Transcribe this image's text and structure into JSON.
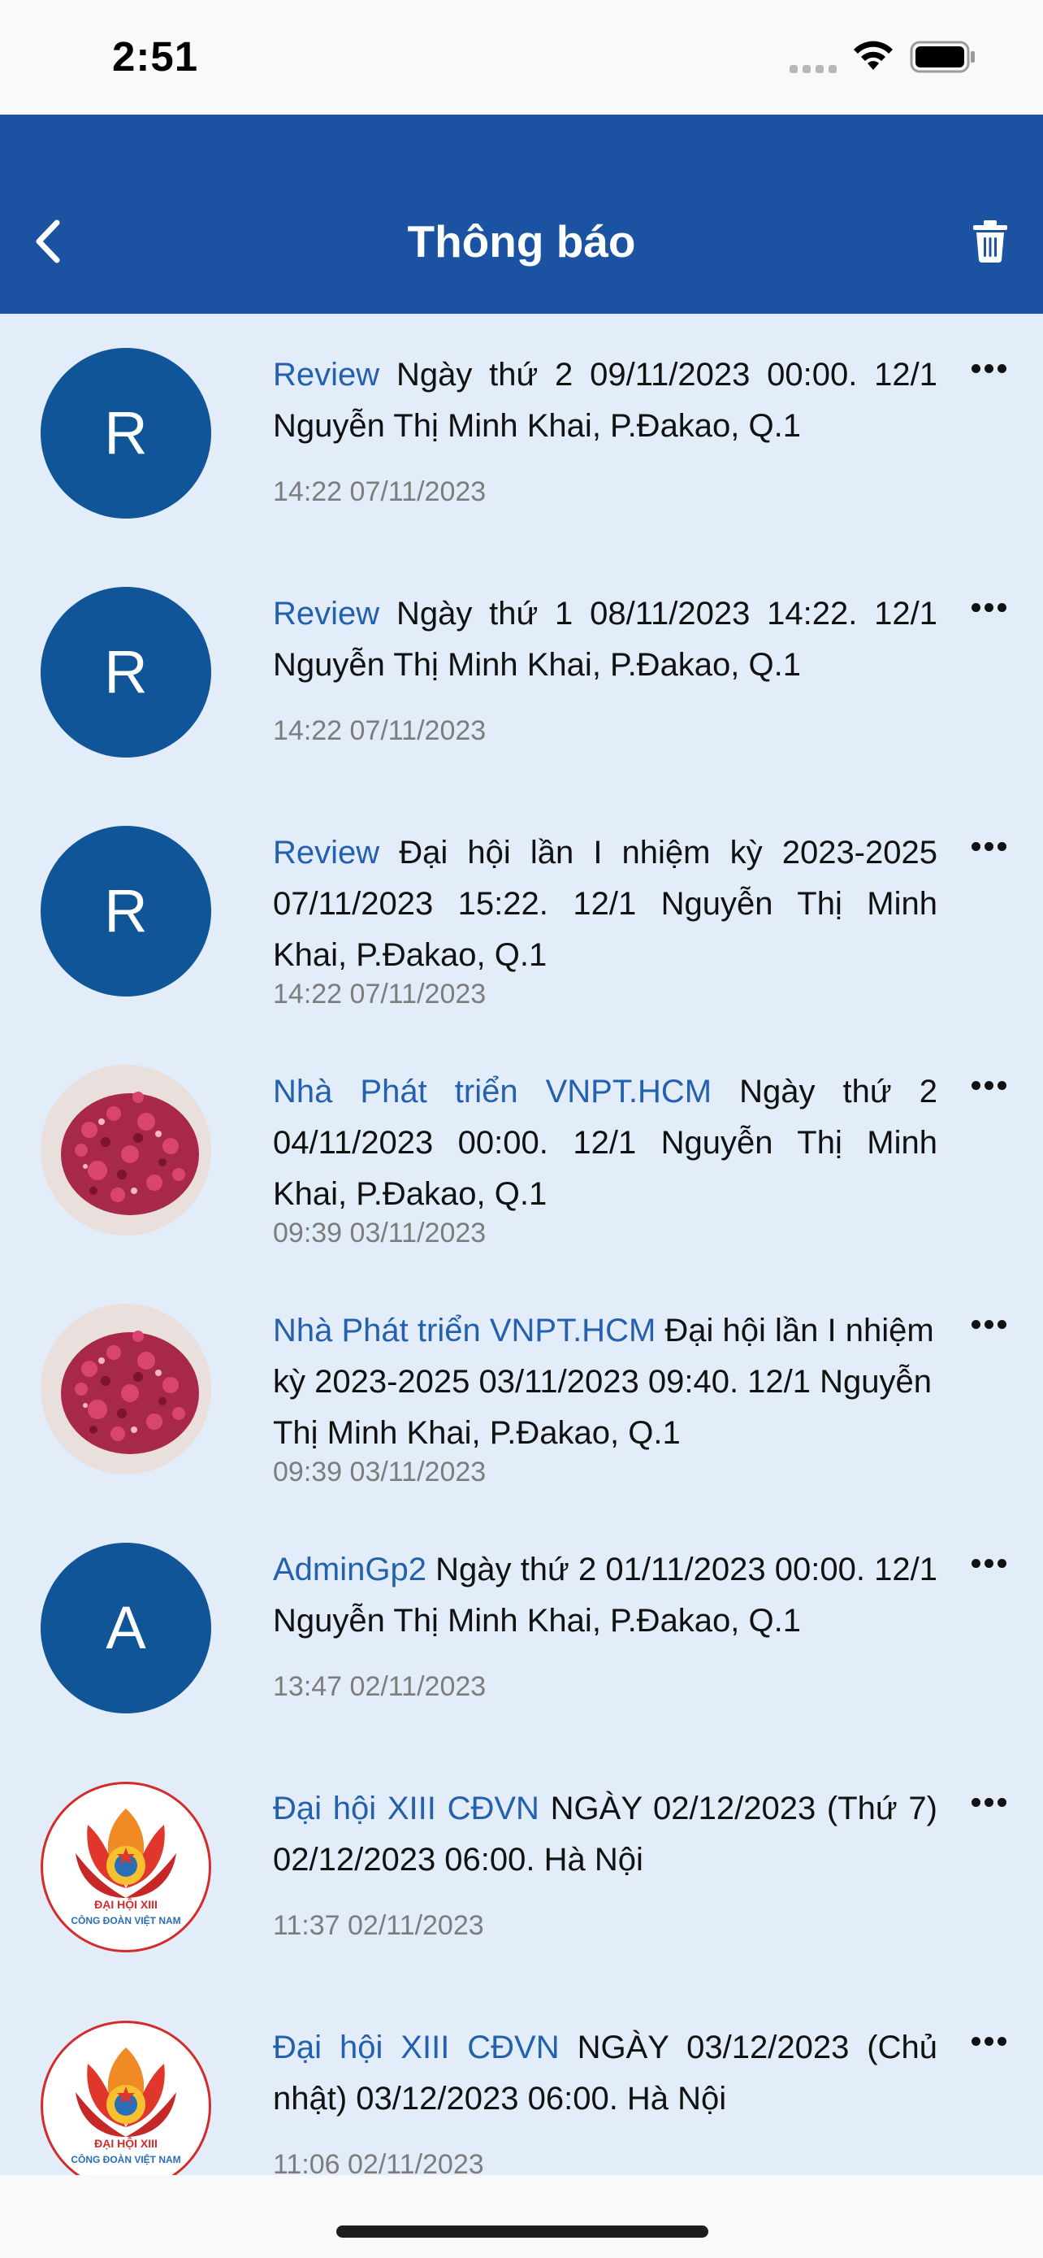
{
  "status_bar": {
    "time": "2:51"
  },
  "header": {
    "title": "Thông báo",
    "back_icon": "chevron-left-icon",
    "delete_icon": "trash-icon"
  },
  "notifications": [
    {
      "avatar_letter": "R",
      "avatar_type": "letter",
      "sender": "Review",
      "message": "Ngày thứ 2 09/11/2023 00:00. 12/1 Nguyễn Thị Minh Khai, P.Đakao, Q.1",
      "time": "14:22 07/11/2023"
    },
    {
      "avatar_letter": "R",
      "avatar_type": "letter",
      "sender": "Review",
      "message": "Ngày thứ 1 08/11/2023 14:22. 12/1 Nguyễn Thị Minh Khai, P.Đakao, Q.1",
      "time": "14:22 07/11/2023"
    },
    {
      "avatar_letter": "R",
      "avatar_type": "letter",
      "sender": "Review",
      "message": "Đại hội lần I nhiệm kỳ 2023-2025 07/11/2023 15:22. 12/1 Nguyễn Thị Minh Khai, P.Đakao, Q.1",
      "time": "14:22 07/11/2023"
    },
    {
      "avatar_type": "photo",
      "sender": "Nhà Phát triển VNPT.HCM",
      "message": "Ngày thứ 2 04/11/2023 00:00. 12/1 Nguyễn Thị Minh Khai, P.Đakao, Q.1",
      "time": "09:39 03/11/2023"
    },
    {
      "avatar_type": "photo",
      "sender": "Nhà Phát triển VNPT.HCM",
      "message": "Đại hội lần I nhiệm kỳ 2023-2025 03/11/2023 09:40. 12/1 Nguyễn Thị Minh Khai, P.Đakao, Q.1",
      "time": "09:39 03/11/2023"
    },
    {
      "avatar_letter": "A",
      "avatar_type": "letter",
      "sender": "AdminGp2",
      "message": "Ngày thứ 2 01/11/2023 00:00. 12/1 Nguyễn Thị Minh Khai, P.Đakao, Q.1",
      "time": "13:47 02/11/2023"
    },
    {
      "avatar_type": "logo",
      "logo_text_1": "ĐẠI HỘI XIII",
      "logo_text_2": "CÔNG ĐOÀN VIỆT NAM",
      "sender": "Đại hội XIII CĐVN",
      "message": "NGÀY 02/12/2023 (Thứ 7) 02/12/2023 06:00. Hà Nội",
      "time": "11:37 02/11/2023"
    },
    {
      "avatar_type": "logo",
      "logo_text_1": "ĐẠI HỘI XIII",
      "logo_text_2": "CÔNG ĐOÀN VIỆT NAM",
      "sender": "Đại hội XIII CĐVN",
      "message": "NGÀY 03/12/2023 (Chủ nhật) 03/12/2023 06:00. Hà Nội",
      "time": "11:06 02/11/2023"
    }
  ],
  "colors": {
    "header": "#1c52a2",
    "background": "#e3edf9",
    "avatar": "#0f5598",
    "sender": "#2360ad"
  }
}
